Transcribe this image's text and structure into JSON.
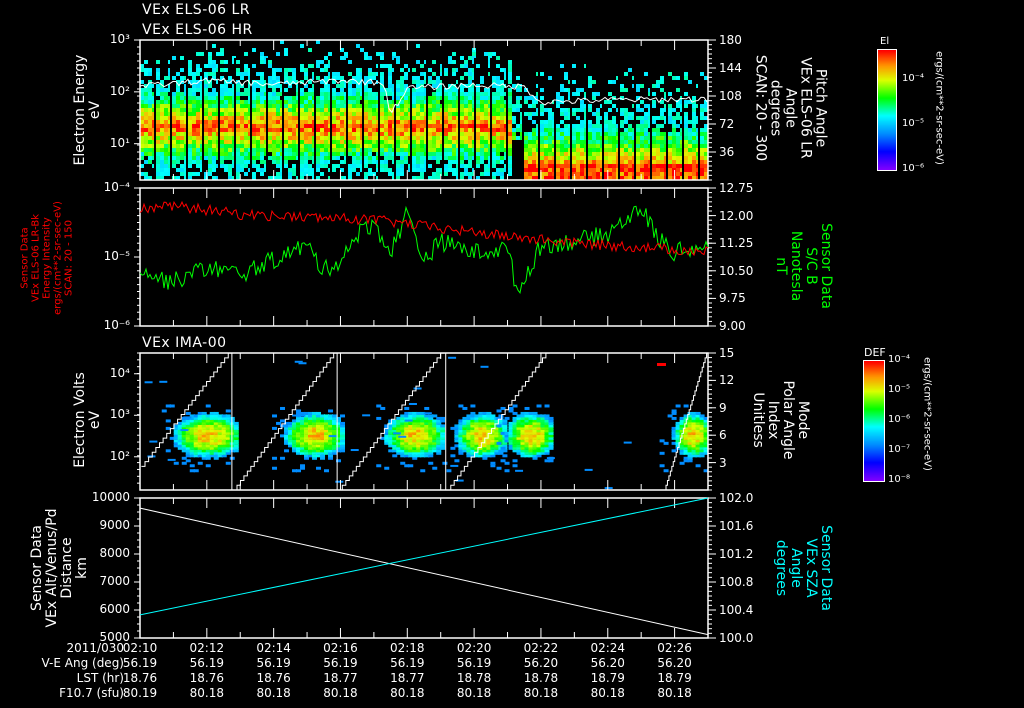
{
  "panel_titles": {
    "top1": "VEx ELS-06 LR",
    "top2": "VEx ELS-06 HR",
    "ima": "VEx IMA-00"
  },
  "colors": {
    "red": "#ff0000",
    "green": "#00ff00",
    "cyan": "#00ffff",
    "white": "#ffffff"
  },
  "colorbars": {
    "els": {
      "title": "El",
      "ticks": [
        "10⁻⁴",
        "10⁻⁵",
        "10⁻⁶"
      ],
      "units": "ergs/(cm**2-sr-sec-eV)"
    },
    "ima": {
      "title": "DEF",
      "ticks": [
        "10⁻⁴",
        "10⁻⁵",
        "10⁻⁶",
        "10⁻⁷",
        "10⁻⁸"
      ],
      "units": "ergs/(cm**2-sr-sec-eV)"
    }
  },
  "chart_data": [
    {
      "type": "heatmap",
      "name": "ELS-06 electron energy spectrogram with pitch angle",
      "ylabel": [
        "Electron Energy",
        "eV"
      ],
      "y_ticks": [
        "10¹",
        "10²",
        "10³"
      ],
      "ylim_log10": [
        0.3,
        3
      ],
      "y2label": [
        "Pitch Angle",
        "VEx ELS-06 LR",
        "Angle",
        "degrees",
        "SCAN: 20 - 300"
      ],
      "y2_ticks": [
        "36",
        "72",
        "108",
        "144",
        "180"
      ],
      "y2lim": [
        0,
        180
      ],
      "peak_energy_log10_before_0221": 1.35,
      "peak_energy_log10_after_0221": 0.5,
      "pitch_angle_line": {
        "t_min": [
          0,
          2,
          4,
          6,
          7.3,
          7.5,
          8,
          10,
          11.5,
          12,
          14,
          17
        ],
        "deg": [
          120,
          128,
          123,
          128,
          125,
          85,
          118,
          122,
          120,
          100,
          103,
          104
        ]
      }
    },
    {
      "type": "line",
      "name": "Energy intensity and magnetic field",
      "ylabel": [
        "Sensor Data",
        "VEx ELS-06 LR-Bk",
        "Energy Intensity",
        "ergs/(cm**2-sr-sec-eV)",
        "SCAN: 20 - 150"
      ],
      "y_ticks": [
        "10⁻⁴",
        "10⁻⁵",
        "10⁻⁶"
      ],
      "ylim": [
        1e-06,
        0.0001
      ],
      "y2label": [
        "Sensor Data",
        "S/C B",
        "Nanotesla",
        "nT"
      ],
      "y2_ticks": [
        "9.00",
        "9.75",
        "10.50",
        "11.25",
        "12.00",
        "12.75"
      ],
      "y2lim": [
        9.0,
        12.75
      ],
      "series": [
        {
          "name": "Energy Intensity",
          "color": "red",
          "t_min": [
            0,
            1,
            3,
            5,
            7,
            9,
            11,
            13,
            15,
            17
          ],
          "values": [
            5e-05,
            5.5e-05,
            4.2e-05,
            3.8e-05,
            3.5e-05,
            2.6e-05,
            2e-05,
            1.6e-05,
            1.4e-05,
            1.2e-05
          ]
        },
        {
          "name": "S/C B",
          "color": "green",
          "t_min": [
            0,
            0.5,
            1,
            2,
            3,
            4,
            5,
            5.5,
            6,
            6.5,
            7,
            7.5,
            8,
            8.5,
            9,
            10,
            11,
            11.3,
            12,
            13,
            14,
            14.5,
            15,
            15.5,
            16,
            17
          ],
          "values": [
            10.6,
            10.3,
            10.2,
            10.6,
            10.4,
            10.8,
            11.2,
            10.5,
            10.8,
            11.5,
            11.8,
            11.0,
            12.1,
            10.8,
            11.3,
            11.0,
            11.1,
            9.9,
            11.2,
            11.3,
            11.5,
            11.9,
            12.2,
            11.4,
            11.0,
            11.2
          ]
        }
      ]
    },
    {
      "type": "heatmap",
      "name": "IMA-00 ion spectrogram with polar angle index",
      "ylabel": [
        "Electron Volts",
        "eV"
      ],
      "y_ticks": [
        "10²",
        "10³",
        "10⁴"
      ],
      "ylim_log10": [
        1.2,
        4.5
      ],
      "y2label": [
        "Mode",
        "Polar Angle",
        "Index",
        "Unitless"
      ],
      "y2_ticks": [
        "3",
        "6",
        "9",
        "12",
        "15"
      ],
      "y2lim": [
        0,
        15
      ],
      "blobs_t_min": [
        [
          1.1,
          2.9
        ],
        [
          4.4,
          6.0
        ],
        [
          7.4,
          9.0
        ],
        [
          9.5,
          10.9
        ],
        [
          11.0,
          12.3
        ],
        [
          16.0,
          17.0
        ]
      ],
      "polar_angle_resets_t_min": [
        2.75,
        5.9,
        9.15
      ]
    },
    {
      "type": "line",
      "name": "Altitude and solar zenith angle",
      "ylabel": [
        "Sensor Data",
        "VEx Alt/Venus/Pd",
        "Distance",
        "km"
      ],
      "y_ticks": [
        "5000",
        "6000",
        "7000",
        "8000",
        "9000",
        "10000"
      ],
      "ylim": [
        5000,
        10000
      ],
      "y2label": [
        "Sensor Data",
        "VEx SZA",
        "Angle",
        "degrees"
      ],
      "y2_ticks": [
        "100.0",
        "100.4",
        "100.8",
        "101.2",
        "101.6",
        "102.0"
      ],
      "y2lim": [
        100.0,
        102.0
      ],
      "series": [
        {
          "name": "Altitude",
          "color": "white",
          "t_min": [
            0,
            17
          ],
          "values": [
            9640,
            5120
          ]
        },
        {
          "name": "SZA",
          "color": "cyan",
          "t_min": [
            0,
            17
          ],
          "values": [
            100.33,
            102.0
          ]
        }
      ]
    }
  ],
  "x_axis": {
    "tlim_min": [
      0,
      17
    ],
    "rows": [
      {
        "label": "2011/030",
        "values": [
          "02:10",
          "02:12",
          "02:14",
          "02:16",
          "02:18",
          "02:20",
          "02:22",
          "02:24",
          "02:26"
        ]
      },
      {
        "label": "V-E Ang (deg)",
        "values": [
          "56.19",
          "56.19",
          "56.19",
          "56.19",
          "56.19",
          "56.19",
          "56.20",
          "56.20",
          "56.20"
        ]
      },
      {
        "label": "LST (hr)",
        "values": [
          "18.76",
          "18.76",
          "18.76",
          "18.77",
          "18.77",
          "18.78",
          "18.78",
          "18.79",
          "18.79"
        ]
      },
      {
        "label": "F10.7 (sfu)",
        "values": [
          "80.19",
          "80.18",
          "80.18",
          "80.18",
          "80.18",
          "80.18",
          "80.18",
          "80.18",
          "80.18"
        ]
      }
    ]
  }
}
